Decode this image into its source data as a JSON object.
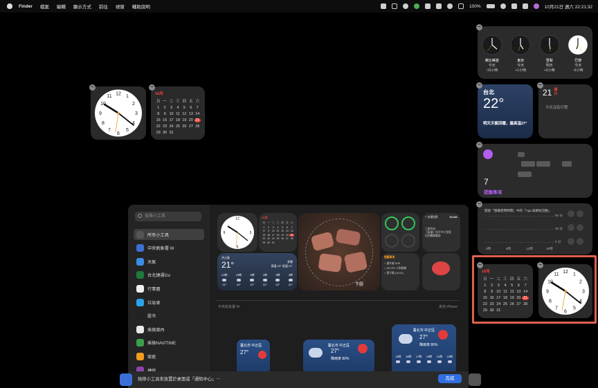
{
  "menubar": {
    "items": [
      "Finder",
      "檔案",
      "編輯",
      "顯示方式",
      "前往",
      "視窗",
      "輔助說明"
    ],
    "battery": "100%",
    "datetime": "10月21日 週六  22:21:32"
  },
  "desktop_calendar": {
    "month": "10月",
    "weekdays": [
      "日",
      "一",
      "二",
      "三",
      "四",
      "五",
      "六"
    ],
    "weeks": [
      [
        "1",
        "2",
        "3",
        "4",
        "5",
        "6",
        "7"
      ],
      [
        "8",
        "9",
        "10",
        "11",
        "12",
        "13",
        "14"
      ],
      [
        "15",
        "16",
        "17",
        "18",
        "19",
        "20",
        "21"
      ],
      [
        "22",
        "23",
        "24",
        "25",
        "26",
        "27",
        "28"
      ],
      [
        "29",
        "30",
        "31",
        "",
        "",
        "",
        ""
      ]
    ],
    "today": "21"
  },
  "world_clocks": [
    {
      "city": "庫比蒂諾",
      "day": "今天",
      "offset": "-15小時"
    },
    {
      "city": "東京",
      "day": "今天",
      "offset": "+1小時"
    },
    {
      "city": "雪梨",
      "day": "明天",
      "offset": "+3小時"
    },
    {
      "city": "巴黎",
      "day": "今天",
      "offset": "-6小時"
    }
  ],
  "weather": {
    "city": "台北",
    "temp": "22°",
    "forecast": "明天天氣回暖，最高溫27°"
  },
  "calendar_small": {
    "day": "21",
    "weekday_line1": "週",
    "weekday_line2": "六",
    "no_events": "今天沒有行程"
  },
  "reminders": {
    "count": "7",
    "label": "提醒事項"
  },
  "screentime": {
    "note": "開啟「螢幕使用時間」中的「App 與網站活動」",
    "y_labels": [
      "60 分",
      "30 分",
      "0 分"
    ],
    "x_labels": [
      "0時",
      "6時",
      "12時",
      "18時"
    ]
  },
  "gallery": {
    "search_placeholder": "搜尋小工具",
    "sidebar": [
      {
        "label": "所有小工具",
        "color": "#555"
      },
      {
        "label": "中央氣象署 W",
        "color": "#3b6fd1"
      },
      {
        "label": "天氣",
        "color": "#3a8ee6"
      },
      {
        "label": "台北捷運Go",
        "color": "#1f7a3d"
      },
      {
        "label": "行事曆",
        "color": "#f0f0f0"
      },
      {
        "label": "垃圾車",
        "color": "#2aa4e8"
      },
      {
        "label": "股市",
        "color": "#222"
      },
      {
        "label": "乘換案內",
        "color": "#e9e9e9"
      },
      {
        "label": "乘換NAVITIME",
        "color": "#3aa14b"
      },
      {
        "label": "家庭",
        "color": "#f29b1f"
      },
      {
        "label": "捷徑",
        "color": "#8e44ad"
      }
    ],
    "weather_widget": {
      "city": "汐止區",
      "temp": "21°",
      "detail": "多雲",
      "hilo": "高溫 23° 低溫 21°",
      "hours": [
        "22時",
        "23時",
        "0時",
        "1時",
        "2時",
        "3時"
      ],
      "temps": [
        "21°",
        "22°",
        "22°",
        "22°",
        "22°",
        "22°"
      ]
    },
    "photo_caption": "下厨",
    "stocks_widget": {
      "label": "Y 加權指數",
      "value": "16,441",
      "lines": [
        "三星科技",
        "《高盛》你不中小型股",
        "回到購買獲取"
      ]
    },
    "reminders_widget": {
      "title": "提醒事項",
      "items": [
        "畫作者 5/39",
        "SKYPE 人和實驗",
        "電子郵 (10:00)"
      ]
    },
    "section_label": "中央氣象署 W",
    "section_right": "來自 iPhone",
    "cwa": [
      {
        "city": "臺北市 中正區",
        "temp": "27°"
      },
      {
        "city": "臺北市 中正區",
        "temp": "27°",
        "extra": "降雨率 80%"
      },
      {
        "city": "臺北市 中正區",
        "temp": "27°",
        "extra": "降雨率 80%",
        "hours": [
          "13時",
          "15時",
          "17時",
          "19時",
          "21時",
          "23時"
        ]
      }
    ],
    "bottom_hint": "拖移小工具來放置於桌面或「通知中心」⋯",
    "done_label": "完成"
  },
  "bottom_calendar": {
    "month": "10月",
    "weekdays": [
      "日",
      "一",
      "二",
      "三",
      "四",
      "五",
      "六"
    ],
    "weeks": [
      [
        "1",
        "2",
        "3",
        "4",
        "5",
        "6",
        "7"
      ],
      [
        "8",
        "9",
        "10",
        "11",
        "12",
        "13",
        "14"
      ],
      [
        "15",
        "16",
        "17",
        "18",
        "19",
        "20",
        "21"
      ],
      [
        "22",
        "23",
        "24",
        "25",
        "26",
        "27",
        "28"
      ],
      [
        "29",
        "30",
        "31",
        "",
        "",
        "",
        ""
      ]
    ],
    "today": "21"
  },
  "colors": {
    "accent_red": "#ff453a",
    "accent_blue": "#2f6fe0",
    "highlight": "#e06050",
    "reminder_purple": "#b05ef0"
  }
}
